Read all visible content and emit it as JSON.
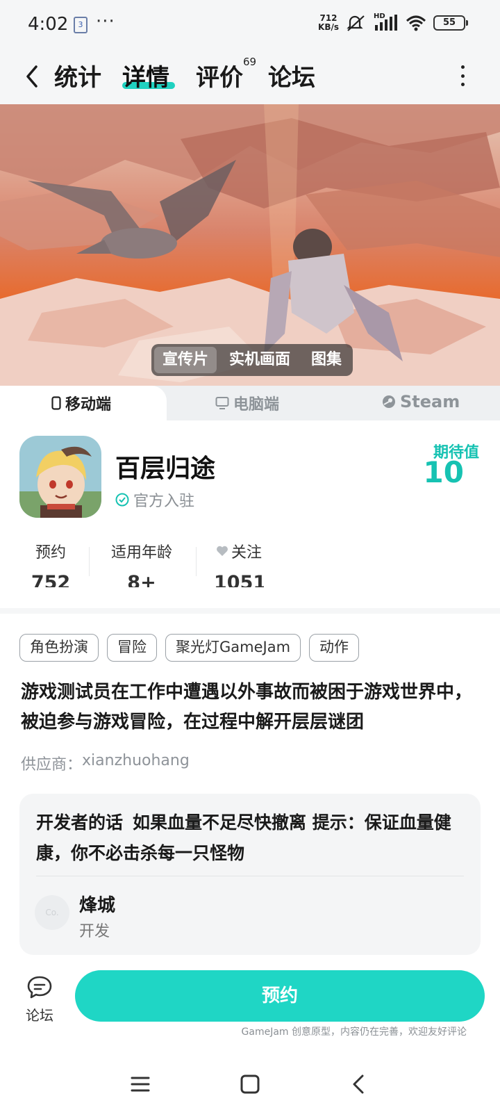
{
  "status_bar": {
    "time": "4:02",
    "notification_badge": "3",
    "dots": "···",
    "net_speed_value": "712",
    "net_speed_unit": "KB/s",
    "hd": "HD",
    "battery": "55"
  },
  "nav": {
    "tabs": [
      "统计",
      "详情",
      "评价",
      "论坛"
    ],
    "active_tab": "详情",
    "review_count": "69"
  },
  "media": {
    "tabs": [
      "宣传片",
      "实机画面",
      "图集"
    ],
    "active_tab": "宣传片"
  },
  "platforms": {
    "tabs": [
      "移动端",
      "电脑端",
      "Steam"
    ],
    "active": "移动端"
  },
  "game": {
    "title": "百层归途",
    "official_label": "官方入驻",
    "expectation_label": "期待值",
    "expectation_value": "10",
    "stats": [
      {
        "label": "预约",
        "value": "752"
      },
      {
        "label": "适用年龄",
        "value": "8+"
      },
      {
        "label": "关注",
        "value": "1051"
      }
    ]
  },
  "tags": [
    "角色扮演",
    "冒险",
    "聚光灯GameJam",
    "动作"
  ],
  "description": "游戏测试员在工作中遭遇以外事故而被困于游戏世界中，被迫参与游戏冒险，在过程中解开层层谜团",
  "supplier": {
    "label": "供应商：",
    "name": "xianzhuohang"
  },
  "developer": {
    "title": "开发者的话",
    "words": "如果血量不足尽快撤离 提示：保证血量健康，你不必击杀每一只怪物",
    "avatar_text": "Co.",
    "name": "烽城",
    "role": "开发"
  },
  "actions": {
    "forum_label": "论坛",
    "reserve_label": "预约",
    "note": "GameJam 创意原型，内容仍在完善，欢迎友好评论"
  },
  "colors": {
    "accent": "#1fd6c5",
    "expectation": "#16c2b2"
  }
}
